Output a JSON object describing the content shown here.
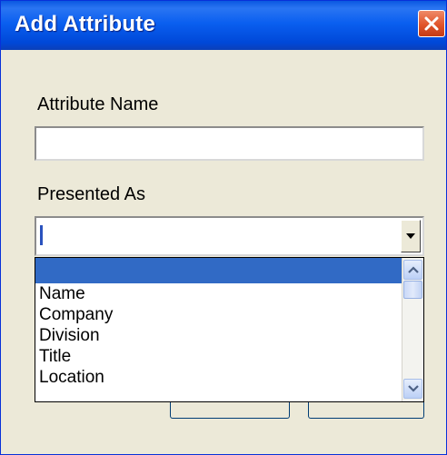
{
  "dialog": {
    "title": "Add Attribute",
    "close_icon": "close-icon"
  },
  "form": {
    "attribute_name_label": "Attribute Name",
    "attribute_name_value": "",
    "presented_as_label": "Presented As",
    "presented_as_value": ""
  },
  "dropdown": {
    "options": [
      "",
      "Name",
      "Company",
      "Division",
      "Title",
      "Location"
    ],
    "selected_index": 0
  },
  "colors": {
    "titlebar": "#0a5ff0",
    "selection": "#316ac5",
    "close": "#e0542a",
    "dialog_bg": "#ece9d8"
  }
}
